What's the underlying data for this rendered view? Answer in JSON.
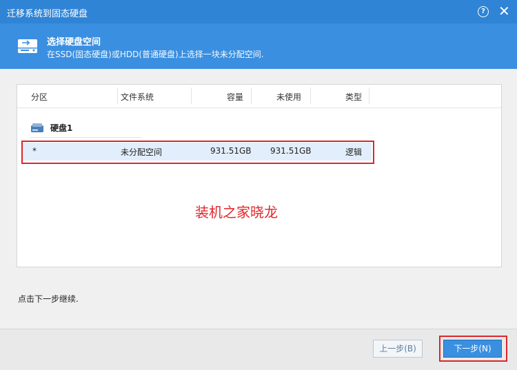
{
  "window": {
    "title": "迁移系统到固态硬盘",
    "help_icon": "help-icon",
    "help_label": "?",
    "close_label": "✕"
  },
  "header": {
    "title": "选择硬盘空间",
    "subtitle": "在SSD(固态硬盘)或HDD(普通硬盘)上选择一块未分配空间."
  },
  "table": {
    "columns": [
      "分区",
      "文件系统",
      "容量",
      "未使用",
      "类型"
    ],
    "disk_label": "硬盘1",
    "rows": [
      {
        "partition": "*",
        "filesystem": "未分配空间",
        "capacity": "931.51GB",
        "unused": "931.51GB",
        "type": "逻辑"
      }
    ]
  },
  "overlay_text": "装机之家晓龙",
  "hint": "点击下一步继续.",
  "buttons": {
    "prev": "上一步(B)",
    "next": "下一步(N)"
  },
  "colors": {
    "titlebar": "#2f84d6",
    "header": "#3a8fe0",
    "highlight_box": "#d9262b",
    "selected_row": "#e2eefb"
  }
}
